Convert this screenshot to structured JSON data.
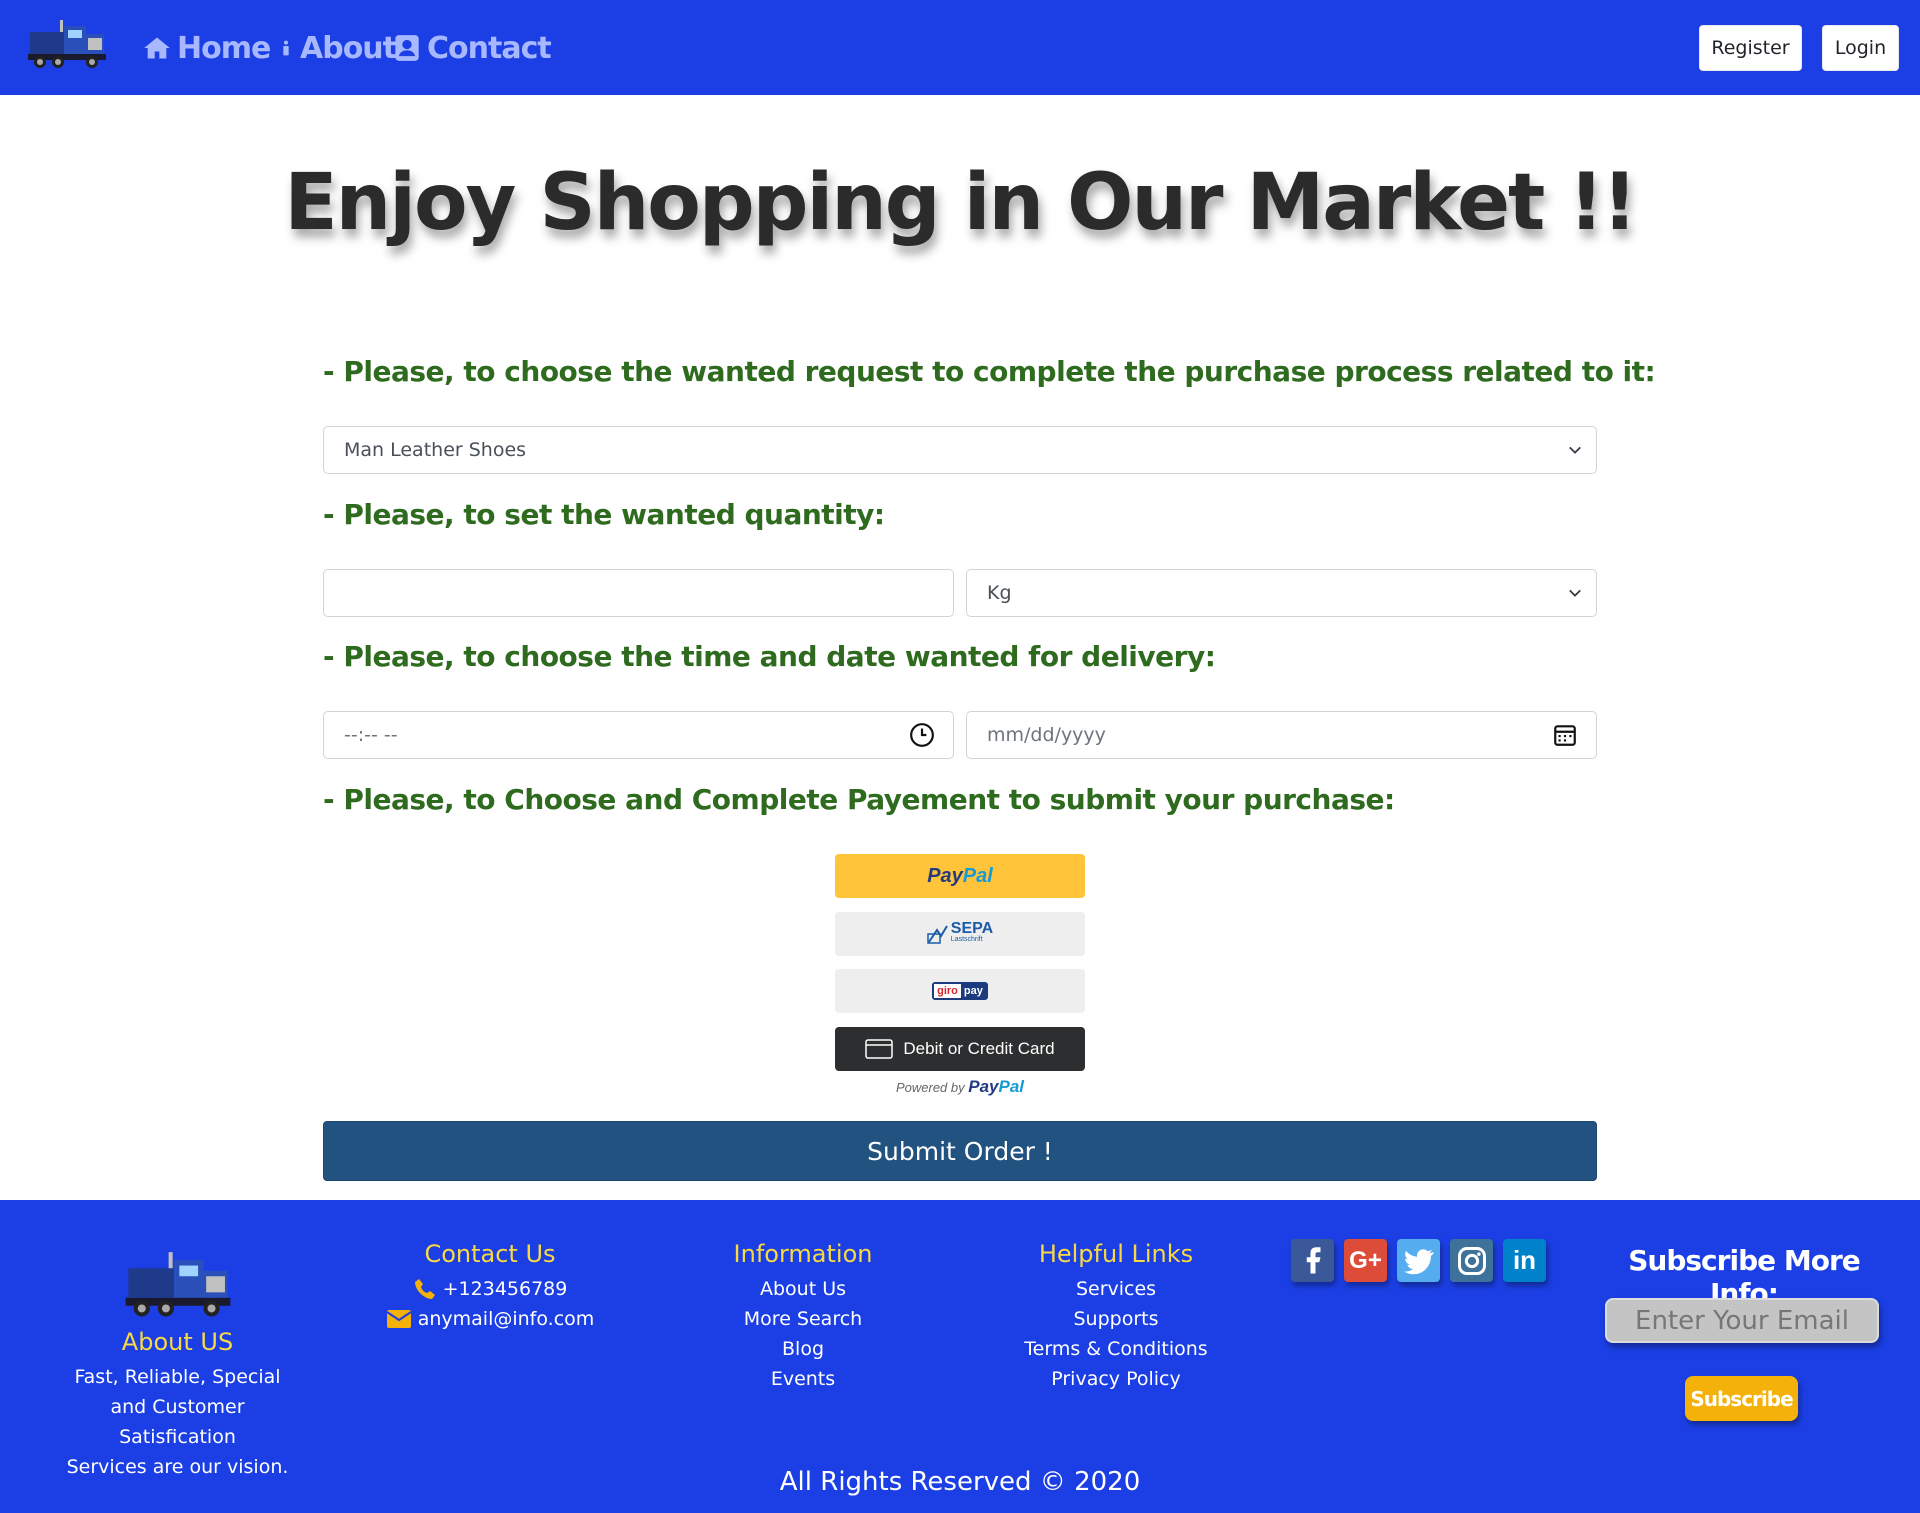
{
  "nav": {
    "links": [
      {
        "label": "Home",
        "icon": "home-icon"
      },
      {
        "label": "About",
        "icon": "info-icon"
      },
      {
        "label": "Contact",
        "icon": "contact-card-icon"
      }
    ],
    "register_label": "Register",
    "login_label": "Login"
  },
  "hero": {
    "title": "Enjoy Shopping in Our Market !!"
  },
  "form": {
    "request_label": "- Please, to choose the wanted request to complete the purchase process related to it:",
    "request_value": "Man Leather Shoes",
    "quantity_label": "- Please, to set the wanted quantity:",
    "quantity_value": "",
    "unit_value": "Kg",
    "delivery_label": "- Please, to choose the time and date wanted for delivery:",
    "time_placeholder": "--:-- --",
    "date_placeholder": "mm/dd/yyyy",
    "payment_label": "- Please, to Choose and Complete Payement to submit your purchase:",
    "submit_label": "Submit Order !"
  },
  "payment": {
    "paypal_part1": "Pay",
    "paypal_part2": "Pal",
    "sepa_label": "SEPA",
    "sepa_sub": "Lastschrift",
    "giro_part1": "giro",
    "giro_part2": "pay",
    "card_label": "Debit or Credit Card",
    "powered_by": "Powered by"
  },
  "footer": {
    "about_title": "About US",
    "about_lines": [
      "Fast, Reliable, Special",
      "and Customer Satisfication",
      "Services are our vision."
    ],
    "contact_title": "Contact Us",
    "phone": "+123456789",
    "email": "anymail@info.com",
    "info_title": "Information",
    "info_links": [
      "About Us",
      "More Search",
      "Blog",
      "Events"
    ],
    "helpful_title": "Helpful Links",
    "helpful_links": [
      "Services",
      "Supports",
      "Terms & Conditions",
      "Privacy Policy"
    ],
    "social": [
      {
        "name": "facebook-icon",
        "color": "#3b5998"
      },
      {
        "name": "google-plus-icon",
        "color": "#dd4b39"
      },
      {
        "name": "twitter-icon",
        "color": "#55acee"
      },
      {
        "name": "instagram-icon",
        "color": "#3f729b"
      },
      {
        "name": "linkedin-icon",
        "color": "#0082ca"
      }
    ],
    "subscribe_title": "Subscribe More Info:",
    "email_placeholder": "Enter Your Email",
    "subscribe_label": "Subscribe",
    "copyright": "All Rights Reserved © 2020"
  },
  "colors": {
    "navbar_bg": "#1b3fe4",
    "label_green": "#2e6b1f",
    "submit_bg": "#22527f",
    "footer_heading": "#f8d943",
    "subscribe_bg": "#f3b10a"
  }
}
